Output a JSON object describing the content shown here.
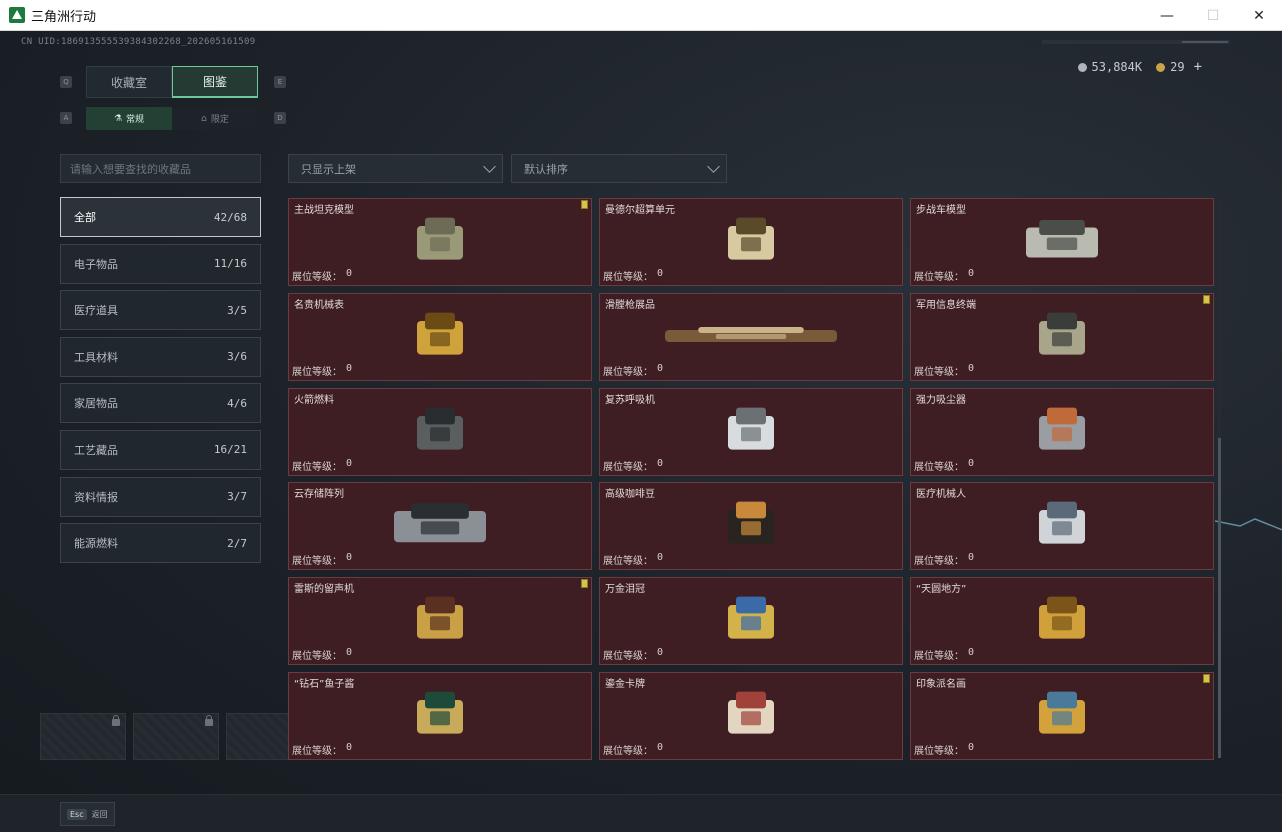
{
  "window": {
    "title": "三角洲行动",
    "minimize": "—",
    "maximize": "☐",
    "close": "✕"
  },
  "uid": "CN UID:1869135555393843022​68_202605161509",
  "currency": {
    "silver": "53,884K",
    "gold": "29",
    "add": "+"
  },
  "key_hints": {
    "q": "Q",
    "e": "E",
    "a": "A",
    "d": "D"
  },
  "tabs": {
    "top": [
      "收藏室",
      "图鉴"
    ],
    "sub": [
      "常规",
      "限定"
    ]
  },
  "search": {
    "placeholder": "请输入想要查找的收藏品"
  },
  "categories": [
    {
      "label": "全部",
      "count": "42/68"
    },
    {
      "label": "电子物品",
      "count": "11/16"
    },
    {
      "label": "医疗道具",
      "count": "3/5"
    },
    {
      "label": "工具材料",
      "count": "3/6"
    },
    {
      "label": "家居物品",
      "count": "4/6"
    },
    {
      "label": "工艺藏品",
      "count": "16/21"
    },
    {
      "label": "资料情报",
      "count": "3/7"
    },
    {
      "label": "能源燃料",
      "count": "2/7"
    }
  ],
  "filters": {
    "shelf": "只显示上架",
    "sort": "默认排序"
  },
  "level_label": "展位等级：",
  "items": [
    {
      "name": "主战坦克模型",
      "level": "0",
      "flag": true,
      "icon": "tank-model-icon"
    },
    {
      "name": "曼德尔超算单元",
      "level": "0",
      "flag": false,
      "icon": "supercomputer-unit-icon"
    },
    {
      "name": "步战车模型",
      "level": "0",
      "flag": false,
      "icon": "ifv-model-icon"
    },
    {
      "name": "名贵机械表",
      "level": "0",
      "flag": false,
      "icon": "mechanical-watch-icon"
    },
    {
      "name": "滑膛枪展品",
      "level": "0",
      "flag": false,
      "icon": "musket-icon"
    },
    {
      "name": "军用信息终端",
      "level": "0",
      "flag": true,
      "icon": "military-terminal-icon"
    },
    {
      "name": "火箭燃料",
      "level": "0",
      "flag": false,
      "icon": "rocket-fuel-icon"
    },
    {
      "name": "复苏呼吸机",
      "level": "0",
      "flag": false,
      "icon": "ventilator-icon"
    },
    {
      "name": "强力吸尘器",
      "level": "0",
      "flag": false,
      "icon": "vacuum-cleaner-icon"
    },
    {
      "name": "云存储阵列",
      "level": "0",
      "flag": false,
      "icon": "storage-array-icon"
    },
    {
      "name": "高级咖啡豆",
      "level": "0",
      "flag": false,
      "icon": "coffee-beans-icon"
    },
    {
      "name": "医疗机械人",
      "level": "0",
      "flag": false,
      "icon": "medical-robot-icon"
    },
    {
      "name": "雷斯的留声机",
      "level": "0",
      "flag": true,
      "icon": "gramophone-icon"
    },
    {
      "name": "万金泪冠",
      "level": "0",
      "flag": false,
      "icon": "jeweled-crown-icon"
    },
    {
      "name": "“天圆地方”",
      "level": "0",
      "flag": false,
      "icon": "armillary-sphere-icon"
    },
    {
      "name": "“钻石”鱼子酱",
      "level": "0",
      "flag": false,
      "icon": "caviar-tin-icon"
    },
    {
      "name": "鎏金卡牌",
      "level": "0",
      "flag": false,
      "icon": "gilded-card-icon"
    },
    {
      "name": "印象派名画",
      "level": "0",
      "flag": true,
      "icon": "framed-painting-icon"
    }
  ],
  "footer": {
    "esc_key": "Esc",
    "back": "返回"
  }
}
